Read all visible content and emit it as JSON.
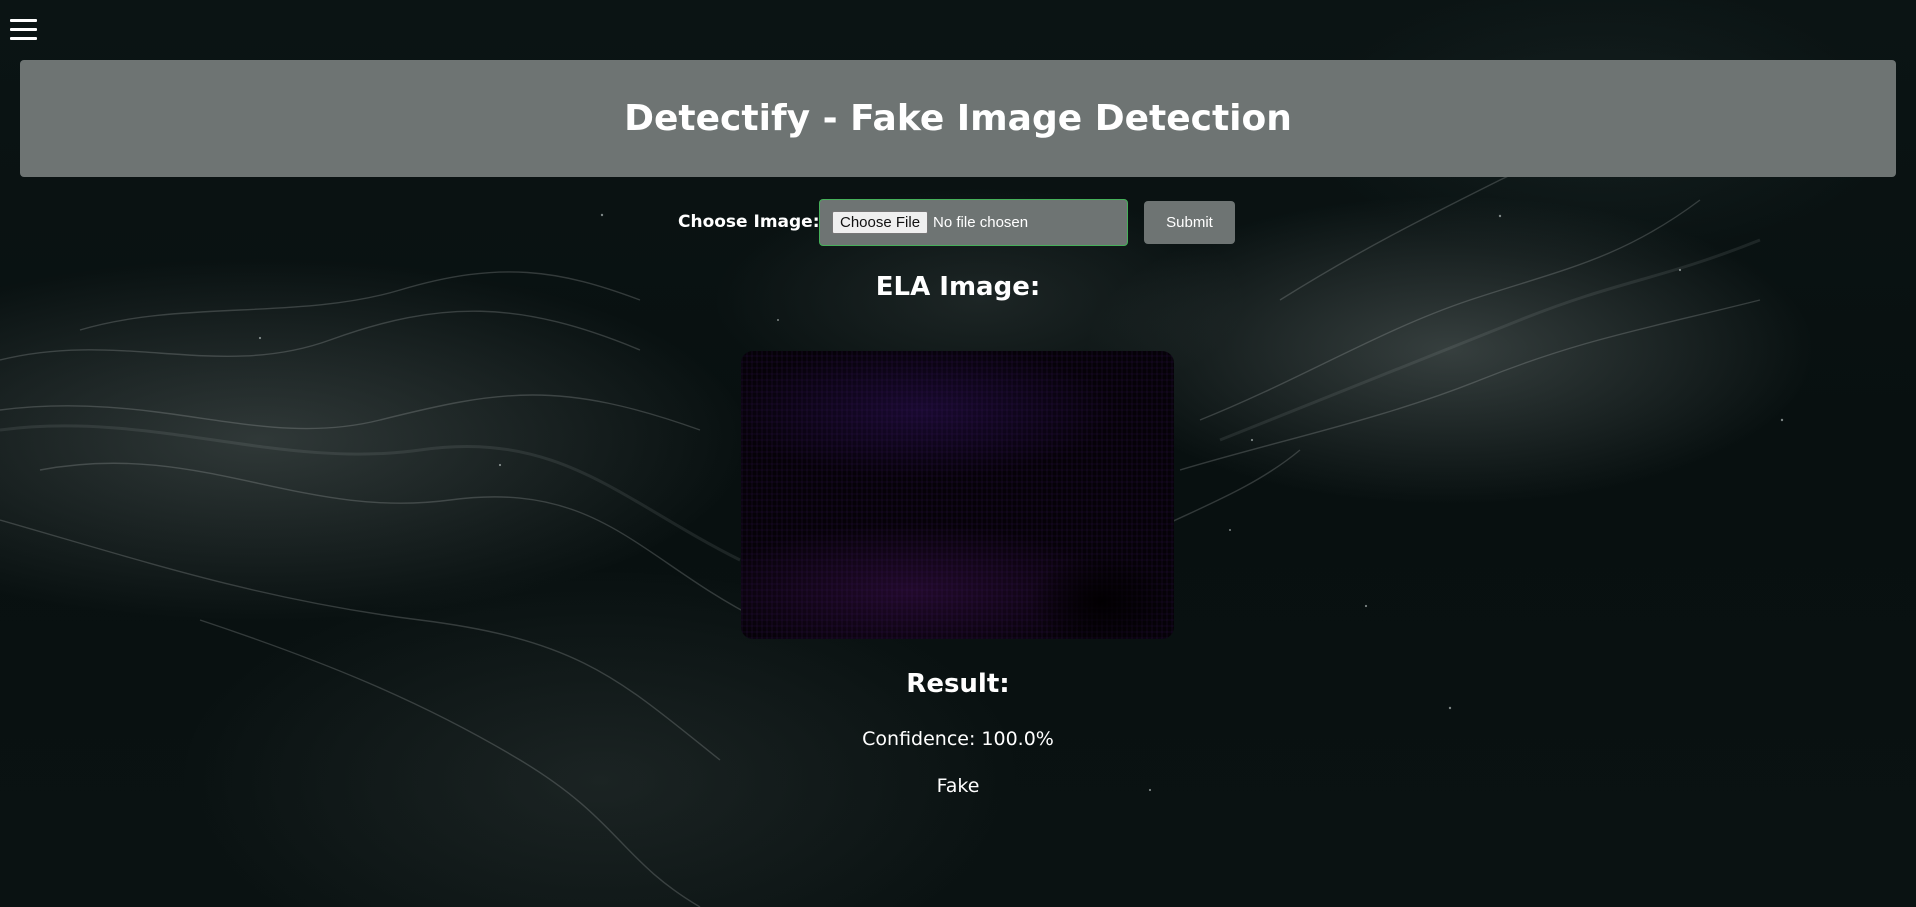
{
  "app": {
    "title": "Detectify - Fake Image Detection"
  },
  "nav": {
    "menu_icon": "hamburger-menu-icon"
  },
  "upload": {
    "label": "Choose Image:",
    "file_button_label": "Choose File",
    "file_status": "No file chosen",
    "submit_label": "Submit"
  },
  "ela": {
    "heading": "ELA Image:"
  },
  "result": {
    "heading": "Result:",
    "confidence": "Confidence: 100.0%",
    "verdict": "Fake"
  },
  "colors": {
    "header_bg": "#6e7473",
    "file_input_border": "#46b05a",
    "text": "#ffffff",
    "page_bg": "#0b1414"
  }
}
